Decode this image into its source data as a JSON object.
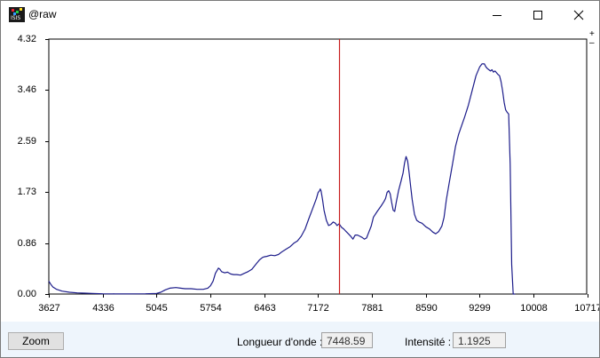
{
  "window": {
    "title": "@raw",
    "icon": "app-icon"
  },
  "window_controls": {
    "minimize": "minimize-icon",
    "maximize": "maximize-icon",
    "close": "close-icon"
  },
  "plot_controls": {
    "zoom_in": "+",
    "zoom_out": "–"
  },
  "chart_data": {
    "type": "line",
    "x": [
      3627,
      3650,
      3680,
      3730,
      3800,
      3900,
      4000,
      4100,
      4200,
      4336,
      4500,
      4700,
      4900,
      5045,
      5100,
      5160,
      5220,
      5300,
      5360,
      5420,
      5500,
      5580,
      5660,
      5720,
      5754,
      5790,
      5820,
      5860,
      5880,
      5900,
      5940,
      5980,
      6020,
      6060,
      6100,
      6150,
      6200,
      6250,
      6300,
      6350,
      6400,
      6440,
      6463,
      6500,
      6550,
      6600,
      6650,
      6700,
      6750,
      6800,
      6850,
      6900,
      6950,
      7000,
      7050,
      7100,
      7150,
      7172,
      7190,
      7200,
      7210,
      7230,
      7250,
      7280,
      7310,
      7340,
      7370,
      7400,
      7420,
      7448,
      7480,
      7510,
      7540,
      7570,
      7600,
      7630,
      7660,
      7690,
      7720,
      7750,
      7780,
      7810,
      7840,
      7870,
      7900,
      7950,
      8000,
      8040,
      8060,
      8080,
      8100,
      8120,
      8140,
      8160,
      8180,
      8200,
      8230,
      8260,
      8290,
      8310,
      8330,
      8350,
      8370,
      8390,
      8410,
      8440,
      8470,
      8500,
      8540,
      8590,
      8640,
      8680,
      8720,
      8760,
      8800,
      8830,
      8860,
      8900,
      8940,
      8980,
      9020,
      9060,
      9100,
      9150,
      9200,
      9250,
      9299,
      9330,
      9360,
      9380,
      9400,
      9420,
      9440,
      9460,
      9480,
      9500,
      9520,
      9540,
      9560,
      9580,
      9600,
      9620,
      9640,
      9660,
      9680,
      9700,
      9720,
      9740,
      9750,
      9760,
      9765,
      9770,
      9780,
      10000,
      10707
    ],
    "series": [
      {
        "values": [
          0.22,
          0.17,
          0.12,
          0.08,
          0.05,
          0.03,
          0.02,
          0.015,
          0.01,
          0.005,
          0.003,
          0.003,
          0.005,
          0.01,
          0.03,
          0.07,
          0.1,
          0.11,
          0.1,
          0.09,
          0.09,
          0.08,
          0.08,
          0.1,
          0.14,
          0.22,
          0.35,
          0.44,
          0.42,
          0.38,
          0.36,
          0.37,
          0.34,
          0.33,
          0.33,
          0.32,
          0.35,
          0.38,
          0.42,
          0.5,
          0.58,
          0.62,
          0.63,
          0.64,
          0.66,
          0.65,
          0.67,
          0.72,
          0.76,
          0.8,
          0.86,
          0.9,
          0.98,
          1.1,
          1.28,
          1.45,
          1.62,
          1.72,
          1.75,
          1.78,
          1.75,
          1.6,
          1.42,
          1.25,
          1.16,
          1.18,
          1.22,
          1.2,
          1.16,
          1.19,
          1.13,
          1.1,
          1.06,
          1.02,
          0.98,
          0.93,
          1.0,
          1.0,
          0.98,
          0.96,
          0.93,
          0.95,
          1.05,
          1.15,
          1.3,
          1.4,
          1.49,
          1.57,
          1.62,
          1.72,
          1.75,
          1.7,
          1.55,
          1.42,
          1.4,
          1.55,
          1.75,
          1.9,
          2.05,
          2.22,
          2.33,
          2.25,
          2.05,
          1.82,
          1.6,
          1.35,
          1.25,
          1.22,
          1.2,
          1.14,
          1.1,
          1.05,
          1.02,
          1.06,
          1.15,
          1.3,
          1.6,
          1.9,
          2.2,
          2.5,
          2.7,
          2.85,
          3.0,
          3.2,
          3.45,
          3.7,
          3.85,
          3.9,
          3.9,
          3.85,
          3.82,
          3.8,
          3.78,
          3.8,
          3.76,
          3.78,
          3.75,
          3.72,
          3.7,
          3.6,
          3.45,
          3.25,
          3.12,
          3.08,
          3.05,
          2.2,
          0.5,
          0.0,
          0.0,
          0.0,
          0.0
        ]
      }
    ],
    "title": "",
    "xlabel": "",
    "ylabel": "",
    "xlim": [
      3627,
      10707
    ],
    "ylim": [
      0,
      4.32
    ],
    "xticks": [
      3627,
      4336,
      5045,
      5754,
      6463,
      7172,
      7881,
      8590,
      9299,
      10008,
      10717
    ],
    "yticks": [
      0.0,
      0.86,
      1.73,
      2.59,
      3.46,
      4.32
    ],
    "xtick_labels": [
      "3627",
      "4336",
      "5045",
      "5754",
      "6463",
      "7172",
      "7881",
      "8590",
      "9299",
      "10008",
      "10717"
    ],
    "ytick_labels": [
      "0.00",
      "0.86",
      "1.73",
      "2.59",
      "3.46",
      "4.32"
    ],
    "cursor_x": 7448.59,
    "colors": {
      "series": "#1c1c8a",
      "cursor": "#c81e1e",
      "axis": "#000000"
    },
    "grid": false
  },
  "status": {
    "zoom_label": "Zoom",
    "wavelength_label": "Longueur d'onde :",
    "wavelength_value": "7448.59",
    "intensity_label": "Intensité :",
    "intensity_value": "1.1925"
  }
}
